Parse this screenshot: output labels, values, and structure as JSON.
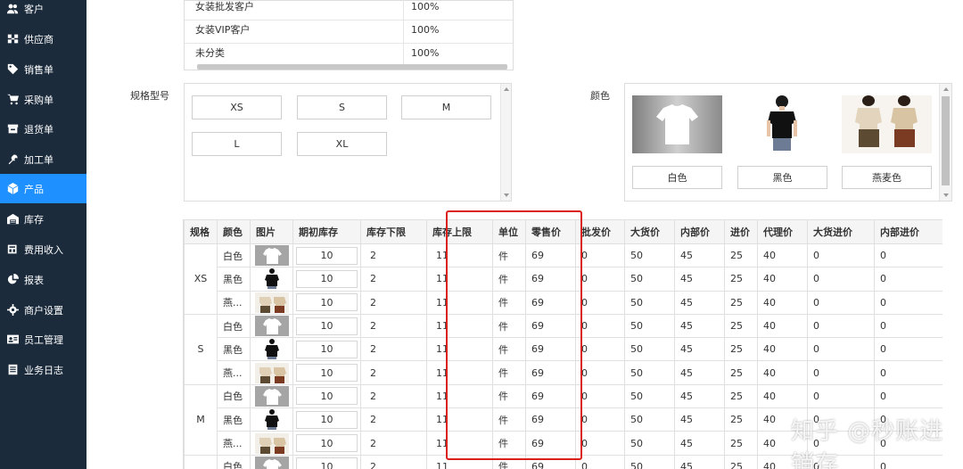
{
  "sidebar": {
    "items": [
      {
        "label": "客户",
        "icon": "users-icon",
        "active": false
      },
      {
        "label": "供应商",
        "icon": "supplier-icon",
        "active": false
      },
      {
        "label": "销售单",
        "icon": "tag-icon",
        "active": false
      },
      {
        "label": "采购单",
        "icon": "cart-icon",
        "active": false
      },
      {
        "label": "退货单",
        "icon": "box-icon",
        "active": false
      },
      {
        "label": "加工单",
        "icon": "tools-icon",
        "active": false
      },
      {
        "label": "产品",
        "icon": "cube-icon",
        "active": true
      },
      {
        "label": "库存",
        "icon": "warehouse-icon",
        "active": false
      },
      {
        "label": "费用收入",
        "icon": "money-icon",
        "active": false
      },
      {
        "label": "报表",
        "icon": "piechart-icon",
        "active": false
      },
      {
        "label": "商户设置",
        "icon": "gear-icon",
        "active": false
      },
      {
        "label": "员工管理",
        "icon": "id-card-icon",
        "active": false
      },
      {
        "label": "业务日志",
        "icon": "log-icon",
        "active": false
      }
    ]
  },
  "customer_pricing": {
    "rows": [
      {
        "name": "女装批发客户",
        "rate": "100%"
      },
      {
        "name": "女装VIP客户",
        "rate": "100%"
      },
      {
        "name": "未分类",
        "rate": "100%"
      }
    ]
  },
  "size_spec": {
    "label": "规格型号",
    "options": [
      "XS",
      "S",
      "M",
      "L",
      "XL"
    ]
  },
  "color_spec": {
    "label": "颜色",
    "options": [
      "白色",
      "黑色",
      "燕麦色"
    ]
  },
  "variant_table": {
    "headers": [
      "规格",
      "颜色",
      "图片",
      "期初库存",
      "库存下限",
      "库存上限",
      "单位",
      "零售价",
      "批发价",
      "大货价",
      "内部价",
      "进价",
      "代理价",
      "大货进价",
      "内部进价"
    ],
    "groups": [
      {
        "size": "XS",
        "rows": [
          {
            "color": "白色",
            "stock": "10",
            "min": "2",
            "max": "11",
            "unit": "件",
            "retail": "69",
            "wholesale": "0",
            "bulk": "50",
            "internal": "45",
            "cost": "25",
            "agent": "40",
            "bulk_cost": "0",
            "internal_cost": "0"
          },
          {
            "color": "黑色",
            "stock": "10",
            "min": "2",
            "max": "11",
            "unit": "件",
            "retail": "69",
            "wholesale": "0",
            "bulk": "50",
            "internal": "45",
            "cost": "25",
            "agent": "40",
            "bulk_cost": "0",
            "internal_cost": "0"
          },
          {
            "color": "燕...",
            "stock": "10",
            "min": "2",
            "max": "11",
            "unit": "件",
            "retail": "69",
            "wholesale": "0",
            "bulk": "50",
            "internal": "45",
            "cost": "25",
            "agent": "40",
            "bulk_cost": "0",
            "internal_cost": "0"
          }
        ]
      },
      {
        "size": "S",
        "rows": [
          {
            "color": "白色",
            "stock": "10",
            "min": "2",
            "max": "11",
            "unit": "件",
            "retail": "69",
            "wholesale": "0",
            "bulk": "50",
            "internal": "45",
            "cost": "25",
            "agent": "40",
            "bulk_cost": "0",
            "internal_cost": "0"
          },
          {
            "color": "黑色",
            "stock": "10",
            "min": "2",
            "max": "11",
            "unit": "件",
            "retail": "69",
            "wholesale": "0",
            "bulk": "50",
            "internal": "45",
            "cost": "25",
            "agent": "40",
            "bulk_cost": "0",
            "internal_cost": "0"
          },
          {
            "color": "燕...",
            "stock": "10",
            "min": "2",
            "max": "11",
            "unit": "件",
            "retail": "69",
            "wholesale": "0",
            "bulk": "50",
            "internal": "45",
            "cost": "25",
            "agent": "40",
            "bulk_cost": "0",
            "internal_cost": "0"
          }
        ]
      },
      {
        "size": "M",
        "rows": [
          {
            "color": "白色",
            "stock": "10",
            "min": "2",
            "max": "11",
            "unit": "件",
            "retail": "69",
            "wholesale": "0",
            "bulk": "50",
            "internal": "45",
            "cost": "25",
            "agent": "40",
            "bulk_cost": "0",
            "internal_cost": "0"
          },
          {
            "color": "黑色",
            "stock": "10",
            "min": "2",
            "max": "11",
            "unit": "件",
            "retail": "69",
            "wholesale": "0",
            "bulk": "50",
            "internal": "45",
            "cost": "25",
            "agent": "40",
            "bulk_cost": "0",
            "internal_cost": "0"
          },
          {
            "color": "燕...",
            "stock": "10",
            "min": "2",
            "max": "11",
            "unit": "件",
            "retail": "69",
            "wholesale": "0",
            "bulk": "50",
            "internal": "45",
            "cost": "25",
            "agent": "40",
            "bulk_cost": "0",
            "internal_cost": "0"
          }
        ]
      },
      {
        "size": "",
        "rows": [
          {
            "color": "白色",
            "stock": "10",
            "min": "2",
            "max": "11",
            "unit": "件",
            "retail": "69",
            "wholesale": "0",
            "bulk": "50",
            "internal": "45",
            "cost": "25",
            "agent": "40",
            "bulk_cost": "0",
            "internal_cost": "0"
          }
        ]
      }
    ]
  },
  "watermark": "知乎 @秒账进销存",
  "colors": {
    "sidebar_bg": "#1b2b3c",
    "sidebar_active": "#1e90ff",
    "highlight_border": "#d9201c"
  }
}
